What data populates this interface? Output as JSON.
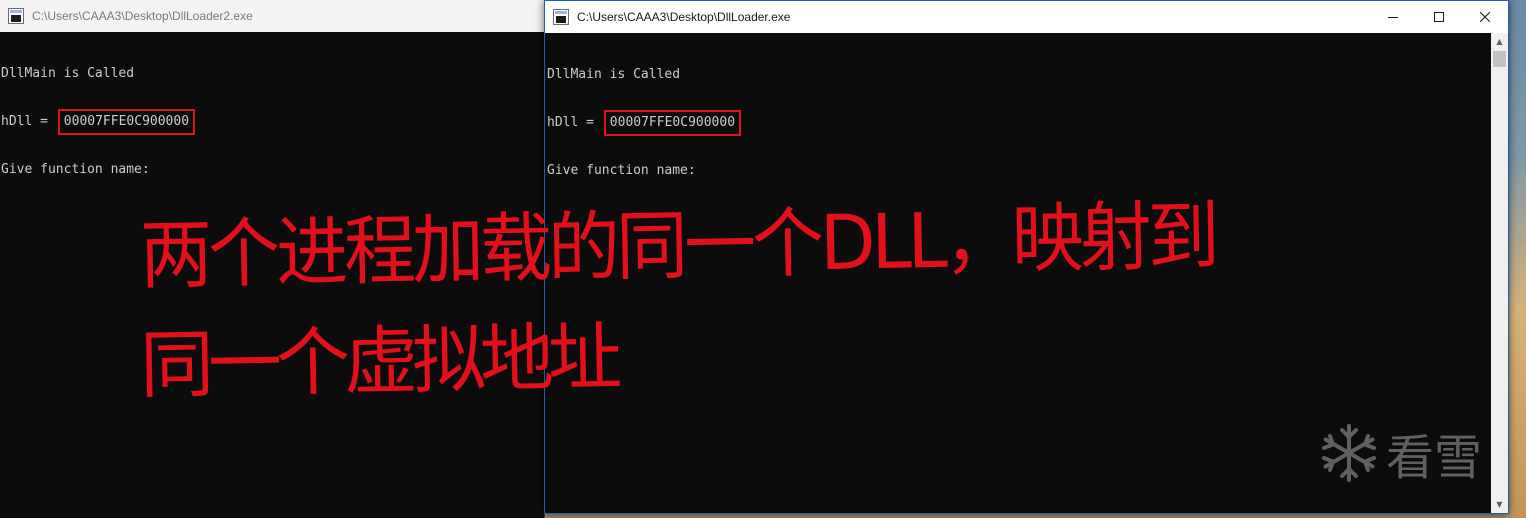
{
  "windows": [
    {
      "title": "C:\\Users\\CAAA3\\Desktop\\DllLoader2.exe",
      "console": {
        "line1": "DllMain is Called",
        "line2_prefix": "hDll = ",
        "line2_address": "00007FFE0C900000",
        "line3": "Give function name:"
      }
    },
    {
      "title": "C:\\Users\\CAAA3\\Desktop\\DllLoader.exe",
      "console": {
        "line1": "DllMain is Called",
        "line2_prefix": "hDll = ",
        "line2_address": "00007FFE0C900000",
        "line3": "Give function name:"
      },
      "controls": {
        "minimize": "minimize",
        "maximize": "maximize",
        "close": "close"
      }
    }
  ],
  "annotation": {
    "line1": "两个进程加载的同一个DLL，映射到",
    "line2": "同一个虚拟地址",
    "color": "#e2101b"
  },
  "watermark": {
    "icon": "snowflake-icon",
    "text": "看雪"
  },
  "colors": {
    "console_bg": "#0c0c0c",
    "console_fg": "#cccccc",
    "highlight": "#e0141c",
    "active_border": "#1e5fb5"
  }
}
